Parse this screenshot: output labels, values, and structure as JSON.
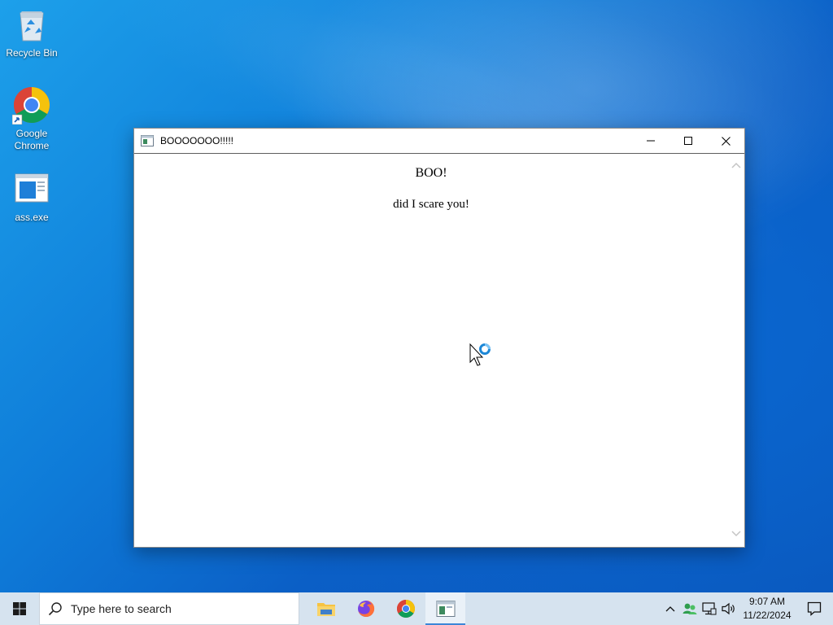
{
  "desktop": {
    "icons": [
      {
        "label": "Recycle Bin",
        "icon": "recycle-bin-icon"
      },
      {
        "label": "Google\nChrome",
        "icon": "chrome-icon"
      },
      {
        "label": "ass.exe",
        "icon": "exe-icon"
      }
    ]
  },
  "window": {
    "title": "BOOOOOOO!!!!!",
    "icon": "app-window-icon",
    "controls": [
      "minimize-icon",
      "maximize-icon",
      "close-icon"
    ],
    "content": {
      "heading": "BOO!",
      "message": "did I scare you!"
    }
  },
  "taskbar": {
    "search_placeholder": "Type here to search",
    "apps": [
      {
        "name": "File Explorer",
        "icon": "folder-icon",
        "active": false
      },
      {
        "name": "Firefox",
        "icon": "firefox-icon",
        "active": false
      },
      {
        "name": "Google Chrome",
        "icon": "chrome-icon",
        "active": false
      },
      {
        "name": "BOOOOOOO!!!!!",
        "icon": "app-window-icon",
        "active": true
      }
    ],
    "tray_icons": [
      "chevron-up-icon",
      "network-people-icon",
      "network-icon",
      "volume-icon"
    ],
    "clock": {
      "time": "9:07 AM",
      "date": "11/22/2024"
    },
    "notification_icon": "notification-icon"
  },
  "colors": {
    "desktop_accent": "#0e7bd8",
    "taskbar_bg": "#d6e3ef",
    "active_indicator": "#3c86d8"
  }
}
